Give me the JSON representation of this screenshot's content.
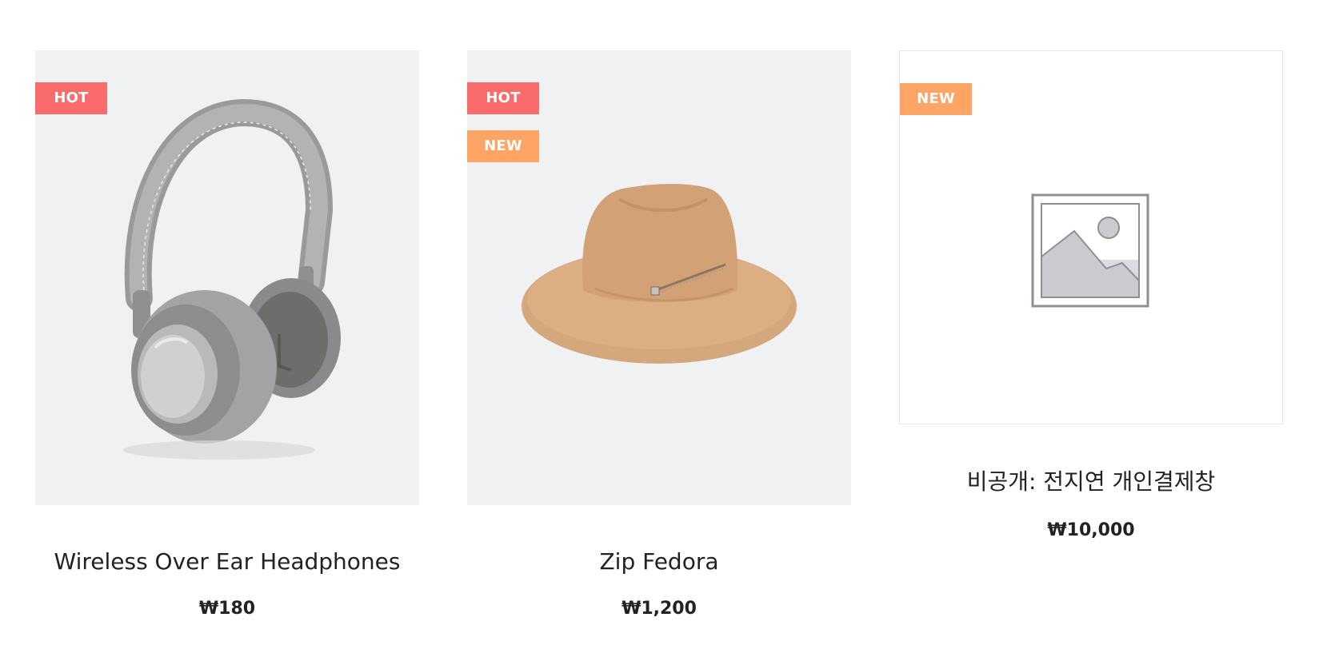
{
  "products": [
    {
      "name": "Wireless Over Ear Headphones",
      "price": "₩180",
      "badges": [
        "HOT"
      ],
      "image": "headphones-image"
    },
    {
      "name": "Zip Fedora",
      "price": "₩1,200",
      "badges": [
        "HOT",
        "NEW"
      ],
      "image": "fedora-image"
    },
    {
      "name": "비공개: 전지연 개인결제창",
      "price": "₩10,000",
      "badges": [
        "NEW"
      ],
      "image": "placeholder-image"
    }
  ],
  "colors": {
    "hot_badge": "#fa6b6b",
    "new_badge": "#fea566",
    "image_bg": "#f0f1f3",
    "text": "#222222"
  }
}
